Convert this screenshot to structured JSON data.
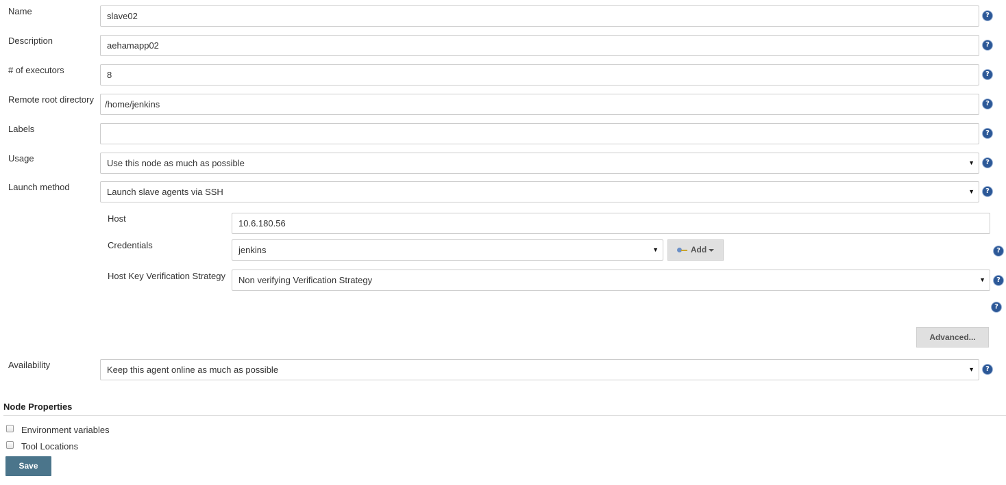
{
  "form": {
    "name": {
      "label": "Name",
      "value": "slave02"
    },
    "description": {
      "label": "Description",
      "value": "aehamapp02"
    },
    "executors": {
      "label": "# of executors",
      "value": "8"
    },
    "remote_root": {
      "label": "Remote root directory",
      "value": "/home/jenkins"
    },
    "labels": {
      "label": "Labels",
      "value": ""
    },
    "usage": {
      "label": "Usage",
      "selected": "Use this node as much as possible"
    },
    "launch_method": {
      "label": "Launch method",
      "selected": "Launch slave agents via SSH"
    },
    "ssh": {
      "host": {
        "label": "Host",
        "value": "10.6.180.56"
      },
      "credentials": {
        "label": "Credentials",
        "selected": "jenkins",
        "add_label": "Add"
      },
      "host_key": {
        "label": "Host Key Verification Strategy",
        "selected": "Non verifying Verification Strategy"
      },
      "advanced_label": "Advanced..."
    },
    "availability": {
      "label": "Availability",
      "selected": "Keep this agent online as much as possible"
    }
  },
  "node_properties": {
    "title": "Node Properties",
    "items": [
      {
        "label": "Environment variables",
        "checked": false
      },
      {
        "label": "Tool Locations",
        "checked": false
      }
    ]
  },
  "save_label": "Save",
  "icons": {
    "help": "help-icon",
    "dropdown": "dropdown-arrow-icon",
    "key": "key-icon",
    "caret": "caret-down-icon"
  },
  "colors": {
    "help": "#2c5897",
    "save_button": "#4b758b",
    "field_border": "#cccccc"
  }
}
